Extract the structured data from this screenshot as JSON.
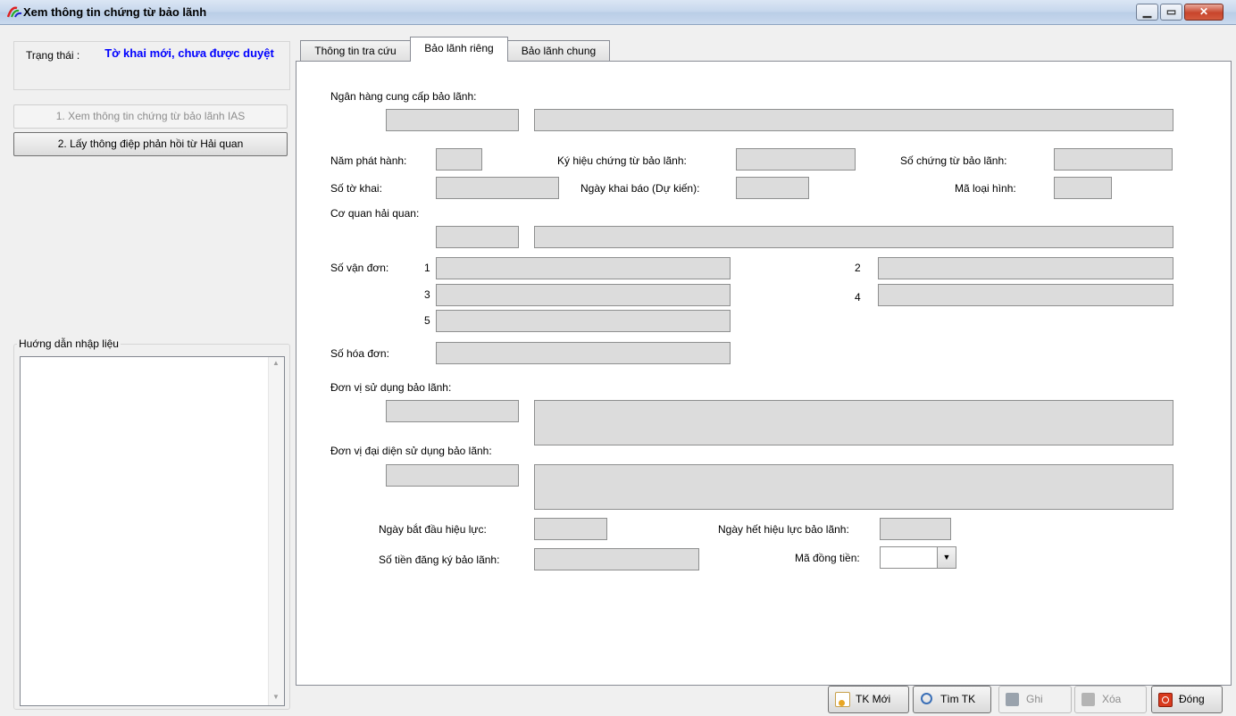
{
  "window": {
    "title": "Xem thông tin chứng từ bảo lãnh",
    "min_icon": "minimize-icon",
    "max_icon": "maximize-icon",
    "close_icon": "close-icon"
  },
  "status": {
    "label": "Trạng thái :",
    "value": "Tờ khai mới, chưa được duyệt"
  },
  "left_buttons": {
    "ias": "1. Xem thông tin chứng từ bảo lãnh IAS",
    "reply": "2. Lấy thông điệp phản hồi từ Hải quan"
  },
  "guide": {
    "title": "Huớng dẫn nhập liệu"
  },
  "tabs": [
    {
      "label": "Thông tin tra cứu"
    },
    {
      "label": "Bảo lãnh riêng"
    },
    {
      "label": "Bảo lãnh chung"
    }
  ],
  "form": {
    "bank_label": "Ngân hàng cung cấp bảo lãnh:",
    "year_label": "Năm phát hành:",
    "symbol_label": "Ký hiệu chứng từ bảo lãnh:",
    "doc_no_label": "Số chứng từ bảo lãnh:",
    "decl_no_label": "Số tờ khai:",
    "decl_date_label": "Ngày khai báo (Dự kiến):",
    "type_code_label": "Mã loại hình:",
    "customs_label": "Cơ quan hải quan:",
    "bill_label": "Số vận đơn:",
    "bill_nums": [
      "1",
      "2",
      "3",
      "4",
      "5"
    ],
    "invoice_label": "Số hóa đơn:",
    "user_unit_label": "Đơn vị sử dụng bảo lãnh:",
    "rep_unit_label": "Đơn vị đại diện sử dụng bảo lãnh:",
    "start_label": "Ngày bắt đầu hiệu lực:",
    "end_label": "Ngày hết hiệu lực bảo lãnh:",
    "amount_label": "Số tiền đăng ký bảo lãnh:",
    "currency_label": "Mã đồng tiền:",
    "currency_value": ""
  },
  "toolbar": {
    "new_label": "TK Mới",
    "new_icon": "new-document-icon",
    "search_label": "Tìm TK",
    "search_icon": "search-icon",
    "save_label": "Ghi",
    "save_icon": "save-icon",
    "delete_label": "Xóa",
    "delete_icon": "delete-icon",
    "close_label": "Đóng",
    "close_icon": "power-icon"
  }
}
